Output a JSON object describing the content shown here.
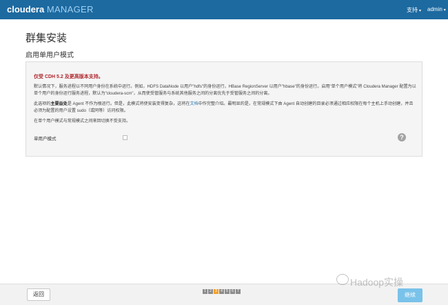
{
  "header": {
    "logo_main": "cloudera",
    "logo_sub": "MANAGER",
    "support_label": "支持",
    "user_label": "admin"
  },
  "page": {
    "title": "群集安装",
    "subtitle": "启用单用户模式"
  },
  "panel": {
    "warning": "仅受 CDH 5.2 及更高版本支持。",
    "para1": "默认情况下，服务进程以不同用户身份在系统中运行。例如，HDFS DataNode 以用户\"hdfs\"的身份运行，HBase RegionServer 以用户\"hbase\"的身份运行。启用\"单个用户模式\"将 Cloudera Manager 配置为以单个用户的身份运行服务进程，默认为\"cloudera-scm\"，从而使受管服务与系统其他服务之间的分离优先于受管服务之间的分离。",
    "para2_a": "此选项的",
    "para2_bold": "主要益处",
    "para2_b": "是 Agent 不作为根运行。但是，此模式将使安装变得复杂，这将在",
    "para2_link": "文档",
    "para2_c": "中作完整介绍。最明显的是，在常规模式下由 Agent 自动创建的目录必须通过相应权限在每个主机上手动创建，并且必须为配置的用户设置 sudo（或同等）访问权限。",
    "para3": "在单个用户模式与常规模式之间来回切换不受支持。",
    "mode_label": "单用户模式",
    "help_glyph": "?"
  },
  "footer": {
    "back_label": "返回",
    "next_label": "继续",
    "pages": [
      {
        "label": "1"
      },
      {
        "label": "2"
      },
      {
        "label": "3"
      },
      {
        "label": "4"
      },
      {
        "label": "5"
      },
      {
        "label": "6"
      },
      {
        "label": "7"
      }
    ],
    "current_page": "3"
  },
  "watermark": {
    "text": "Hadoop实操"
  },
  "colors": {
    "topbar": "#1d6aa0",
    "warning": "#b0262c",
    "active_page": "#f0a12a",
    "next_button": "#79c2ea",
    "link": "#2a7ab8"
  },
  "icons": {
    "help": "question-circle-icon",
    "support_caret": "chevron-down-icon",
    "user_caret": "chevron-down-icon",
    "watermark": "wechat-icon"
  }
}
